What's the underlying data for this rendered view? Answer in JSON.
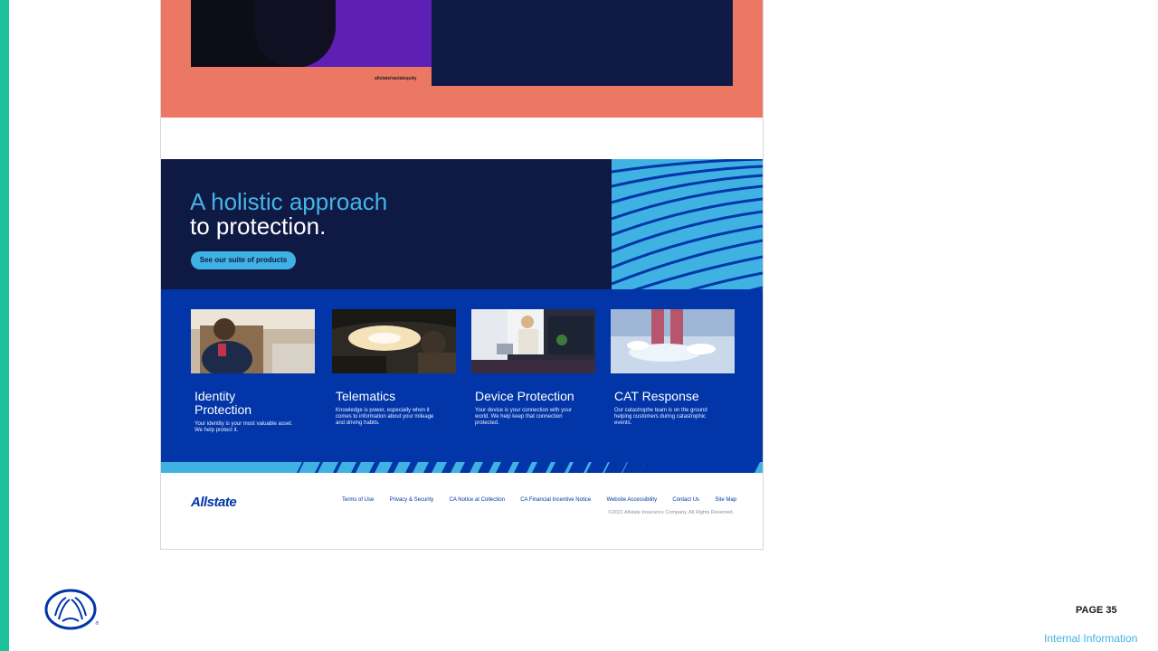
{
  "slide": {
    "page_label": "PAGE 35",
    "classification": "Internal Information",
    "accent_color": "#1ec29a"
  },
  "top_section": {
    "url_text": "allstate/racialequity"
  },
  "hero": {
    "title_line1": "A holistic approach",
    "title_line2": "to protection.",
    "button_label": "See our suite of products"
  },
  "products": [
    {
      "title": "Identity Protection",
      "description": "Your identity is your most valuable asset. We help protect it."
    },
    {
      "title": "Telematics",
      "description": "Knowledge is power, especially when it comes to information about your mileage and driving habits."
    },
    {
      "title": "Device Protection",
      "description": "Your device is your connection with your world. We help keep that connection protected."
    },
    {
      "title": "CAT Response",
      "description": "Our catastrophe team is on the ground helping customers during catastrophic events."
    }
  ],
  "footer": {
    "logo_text": "Allstate",
    "links": [
      "Terms of Use",
      "Privacy & Security",
      "CA Notice at Collection",
      "CA Financial Incentive Notice",
      "Website Accessibility",
      "Contact Us",
      "Site Map"
    ],
    "copyright": "©2021 Allstate Insurance Company. All Rights Reserved."
  },
  "colors": {
    "navy": "#0e1a44",
    "royal_blue": "#0236a8",
    "sky_blue": "#3fb2e3",
    "coral": "#ec7763"
  }
}
